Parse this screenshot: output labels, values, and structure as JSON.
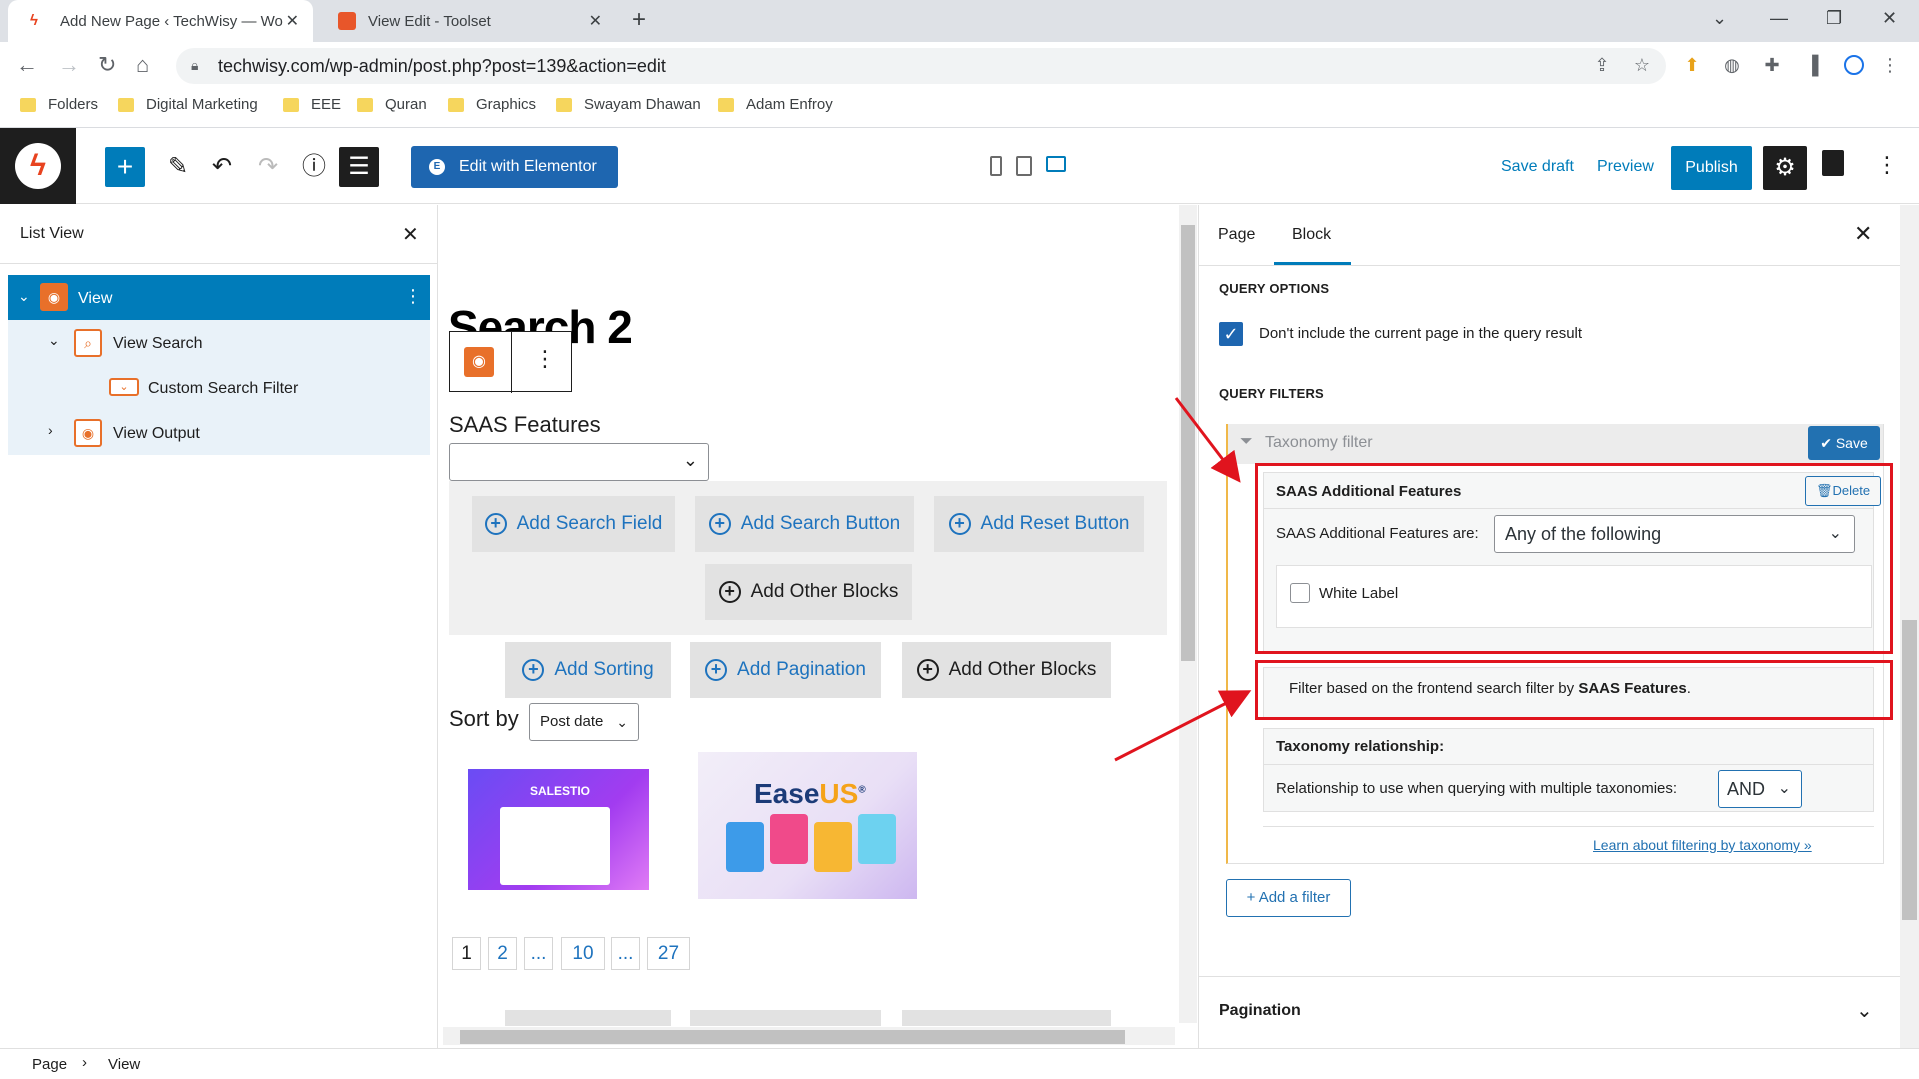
{
  "browser": {
    "tabs": [
      {
        "title": "Add New Page ‹ TechWisy — Wo",
        "active": true
      },
      {
        "title": "View Edit - Toolset",
        "active": false
      }
    ],
    "url": "techwisy.com/wp-admin/post.php?post=139&action=edit",
    "bookmarks": [
      "Folders",
      "Digital Marketing",
      "EEE",
      "Quran",
      "Graphics",
      "Swayam Dhawan",
      "Adam Enfroy"
    ]
  },
  "editor_toolbar": {
    "elementor_label": "Edit with Elementor",
    "save_draft": "Save draft",
    "preview": "Preview",
    "publish": "Publish"
  },
  "list_view": {
    "title": "List View",
    "items": [
      {
        "label": "View",
        "selected": true
      },
      {
        "label": "View Search"
      },
      {
        "label": "Custom Search Filter"
      },
      {
        "label": "View Output"
      }
    ]
  },
  "canvas": {
    "page_title": "Search 2",
    "saas_label": "SAAS Features",
    "buttons": {
      "add_search_field": "Add Search Field",
      "add_search_button": "Add Search Button",
      "add_reset_button": "Add Reset Button",
      "add_other_blocks": "Add Other Blocks",
      "add_sorting": "Add Sorting",
      "add_pagination": "Add Pagination",
      "add_other_blocks_2": "Add Other Blocks"
    },
    "sort_label": "Sort by",
    "sort_value": "Post date",
    "thumb1_brand": "SALESTIO",
    "thumb2_brand_a": "Ease",
    "thumb2_brand_b": "US",
    "thumb2_reg": "®",
    "pages": [
      "1",
      "2",
      "...",
      "10",
      "...",
      "27"
    ]
  },
  "sidebar": {
    "tabs": [
      "Page",
      "Block"
    ],
    "query_options_heading": "QUERY OPTIONS",
    "exclude_current_label": "Don't include the current page in the query result",
    "query_filters_heading": "QUERY FILTERS",
    "filter_title": "Taxonomy filter",
    "save_label": "Save",
    "taxonomy_name": "SAAS Additional Features",
    "delete_label": "Delete",
    "are_label": "SAAS Additional Features are:",
    "are_value": "Any of the following",
    "term_label": "White Label",
    "note_prefix": "Filter based on the frontend search filter by ",
    "note_bold": "SAAS Features",
    "note_suffix": ".",
    "relationship_title": "Taxonomy relationship:",
    "relationship_label": "Relationship to use when querying with multiple taxonomies:",
    "relationship_value": "AND",
    "learn_link": "Learn about filtering by taxonomy »",
    "add_filter": "Add a filter",
    "pagination_heading": "Pagination"
  },
  "breadcrumb": [
    "Page",
    "View"
  ],
  "colors": {
    "wp_blue": "#007cba",
    "annotation_red": "#e0141e",
    "toolset_orange": "#e8702a"
  }
}
